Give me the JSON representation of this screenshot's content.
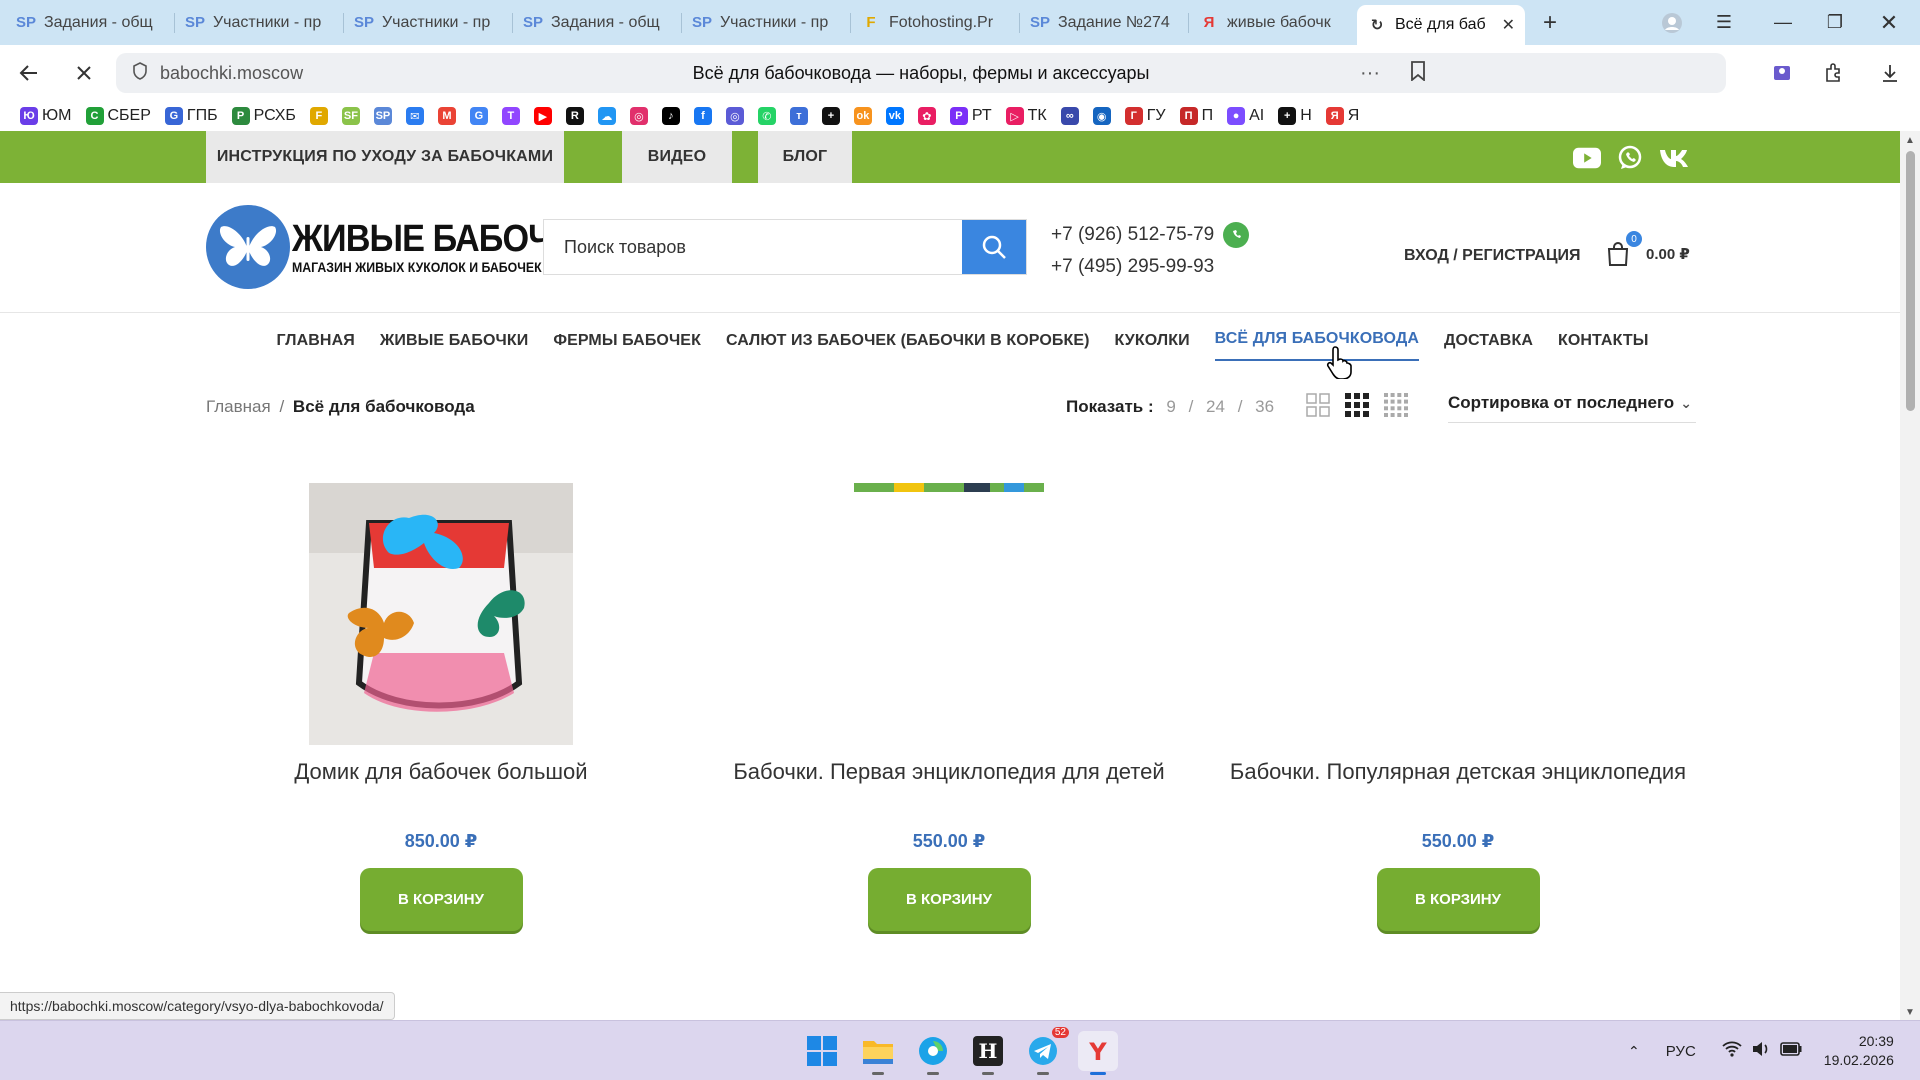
{
  "browser": {
    "tabs": [
      {
        "title": "Задания - общ",
        "fav": "SP",
        "favcolor": "#5b88d8"
      },
      {
        "title": "Участники - пр",
        "fav": "SP",
        "favcolor": "#5b88d8"
      },
      {
        "title": "Участники - пр",
        "fav": "SP",
        "favcolor": "#5b88d8"
      },
      {
        "title": "Задания - общ",
        "fav": "SP",
        "favcolor": "#5b88d8"
      },
      {
        "title": "Участники - пр",
        "fav": "SP",
        "favcolor": "#5b88d8"
      },
      {
        "title": "Fotohosting.Pr",
        "fav": "F",
        "favcolor": "#e0a800"
      },
      {
        "title": "Задание №274",
        "fav": "SP",
        "favcolor": "#5b88d8"
      },
      {
        "title": "живые бабочк",
        "fav": "Я",
        "favcolor": "#e53935"
      },
      {
        "title": "Всё для баб",
        "fav": "↻",
        "favcolor": "#333"
      }
    ],
    "address": "babochki.moscow",
    "page_title": "Всё для бабочковода — наборы, фермы и аксессуары",
    "bookmarks": [
      {
        "label": "ЮМ",
        "color": "#6a3de8",
        "glyph": "Ю"
      },
      {
        "label": "СБЕР",
        "color": "#21a038",
        "glyph": "С"
      },
      {
        "label": "ГПБ",
        "color": "#3866d6",
        "glyph": "G"
      },
      {
        "label": "РСХБ",
        "color": "#2d8a3e",
        "glyph": "Р"
      },
      {
        "label": "",
        "color": "#e0a800",
        "glyph": "F"
      },
      {
        "label": "",
        "color": "#8bc34a",
        "glyph": "SF"
      },
      {
        "label": "",
        "color": "#5b88d8",
        "glyph": "SP"
      },
      {
        "label": "",
        "color": "#2b7cf0",
        "glyph": "✉"
      },
      {
        "label": "",
        "color": "#ea4335",
        "glyph": "M"
      },
      {
        "label": "",
        "color": "#4285f4",
        "glyph": "G"
      },
      {
        "label": "",
        "color": "#9146ff",
        "glyph": "T"
      },
      {
        "label": "",
        "color": "#ff0000",
        "glyph": "▶"
      },
      {
        "label": "",
        "color": "#111",
        "glyph": "R"
      },
      {
        "label": "",
        "color": "#2196f3",
        "glyph": "☁"
      },
      {
        "label": "",
        "color": "#e1306c",
        "glyph": "◎"
      },
      {
        "label": "",
        "color": "#000",
        "glyph": "♪"
      },
      {
        "label": "",
        "color": "#1877f2",
        "glyph": "f"
      },
      {
        "label": "",
        "color": "#5b5bd6",
        "glyph": "◎"
      },
      {
        "label": "",
        "color": "#25d366",
        "glyph": "✆"
      },
      {
        "label": "",
        "color": "#3d6fd8",
        "glyph": "т"
      },
      {
        "label": "",
        "color": "#111",
        "glyph": "+"
      },
      {
        "label": "",
        "color": "#f7931e",
        "glyph": "ok"
      },
      {
        "label": "",
        "color": "#0077ff",
        "glyph": "vk"
      },
      {
        "label": "",
        "color": "#e91e63",
        "glyph": "✿"
      },
      {
        "label": "РТ",
        "color": "#7b2ff7",
        "glyph": "Р"
      },
      {
        "label": "ТК",
        "color": "#e91e63",
        "glyph": "▷"
      },
      {
        "label": "",
        "color": "#3949ab",
        "glyph": "∞"
      },
      {
        "label": "",
        "color": "#1565c0",
        "glyph": "◉"
      },
      {
        "label": "ГУ",
        "color": "#d32f2f",
        "glyph": "Г"
      },
      {
        "label": "П",
        "color": "#c62828",
        "glyph": "П"
      },
      {
        "label": "AI",
        "color": "#7c4dff",
        "glyph": "●"
      },
      {
        "label": "Н",
        "color": "#111",
        "glyph": "+"
      },
      {
        "label": "Я",
        "color": "#e53935",
        "glyph": "Я"
      }
    ]
  },
  "site": {
    "toplinks": [
      "ИНСТРУКЦИЯ ПО УХОДУ ЗА БАБОЧКАМИ",
      "ВИДЕО",
      "БЛОГ"
    ],
    "logo_line1": "ЖИВЫЕ БАБОЧКИ",
    "logo_line2": "МАГАЗИН ЖИВЫХ КУКОЛОК И БАБОЧЕК",
    "search_placeholder": "Поиск товаров",
    "phone1": "+7 (926) 512-75-79",
    "phone2": "+7 (495) 295-99-93",
    "login": "ВХОД / РЕГИСТРАЦИЯ",
    "cart_count": "0",
    "cart_total": "0.00 ₽",
    "nav": [
      "ГЛАВНАЯ",
      "ЖИВЫЕ БАБОЧКИ",
      "ФЕРМЫ БАБОЧЕК",
      "САЛЮТ ИЗ БАБОЧЕК (БАБОЧКИ В КОРОБКЕ)",
      "КУКОЛКИ",
      "ВСЁ ДЛЯ БАБОЧКОВОДА",
      "ДОСТАВКА",
      "КОНТАКТЫ"
    ],
    "crumb_home": "Главная",
    "crumb_current": "Всё для бабочковода",
    "show_label": "Показать :",
    "show_opts": [
      "9",
      "24",
      "36"
    ],
    "sort_label": "Сортировка от последнего",
    "products": [
      {
        "name": "Домик для бабочек большой",
        "price": "850.00 ₽",
        "button": "В КОРЗИНУ"
      },
      {
        "name": "Бабочки. Первая энциклопедия для детей",
        "price": "550.00 ₽",
        "button": "В КОРЗИНУ"
      },
      {
        "name": "Бабочки. Популярная детская энциклопедия",
        "price": "550.00 ₽",
        "button": "В КОРЗИНУ"
      }
    ],
    "status_url": "https://babochki.moscow/category/vsyo-dlya-babochkovoda/"
  },
  "taskbar": {
    "telegram_badge": "52",
    "lang": "РУС",
    "time": "20:39",
    "date": "19.02.2026"
  },
  "colors": {
    "green": "#7db236",
    "blue": "#3a86e0",
    "price": "#3a6fb8"
  }
}
